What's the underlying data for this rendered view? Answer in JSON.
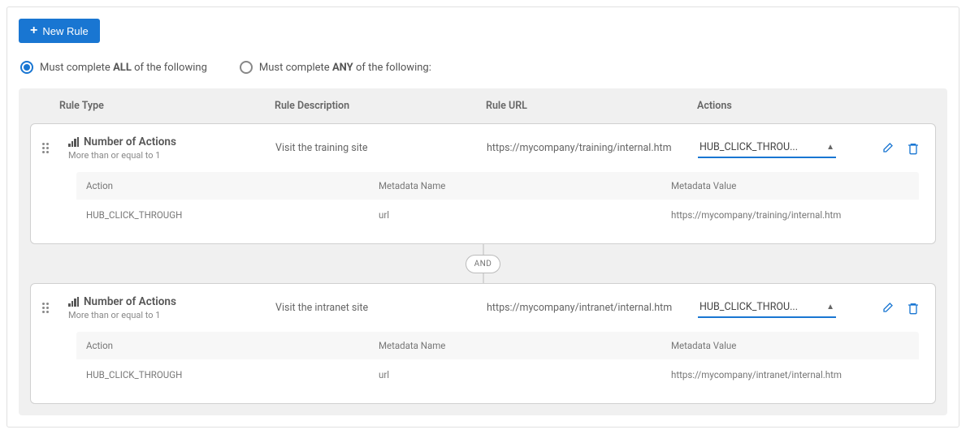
{
  "buttons": {
    "new_rule": "New Rule"
  },
  "radios": {
    "all_prefix": "Must complete ",
    "all_strong": "ALL",
    "all_suffix": " of the following",
    "any_prefix": "Must complete ",
    "any_strong": "ANY",
    "any_suffix": " of the following:"
  },
  "headers": {
    "type": "Rule Type",
    "desc": "Rule Description",
    "url": "Rule URL",
    "actions": "Actions"
  },
  "detail_headers": {
    "action": "Action",
    "name": "Metadata Name",
    "value": "Metadata Value"
  },
  "connector": "AND",
  "rules": [
    {
      "type_title": "Number of Actions",
      "type_sub": "More than or equal to 1",
      "desc": "Visit the training site",
      "url": "https://mycompany/training/internal.htm",
      "action_display": "HUB_CLICK_THROU...",
      "detail": {
        "action": "HUB_CLICK_THROUGH",
        "name": "url",
        "value": "https://mycompany/training/internal.htm"
      }
    },
    {
      "type_title": "Number of Actions",
      "type_sub": "More than or equal to 1",
      "desc": "Visit the intranet site",
      "url": "https://mycompany/intranet/internal.htm",
      "action_display": "HUB_CLICK_THROU...",
      "detail": {
        "action": "HUB_CLICK_THROUGH",
        "name": "url",
        "value": "https://mycompany/intranet/internal.htm"
      }
    }
  ]
}
